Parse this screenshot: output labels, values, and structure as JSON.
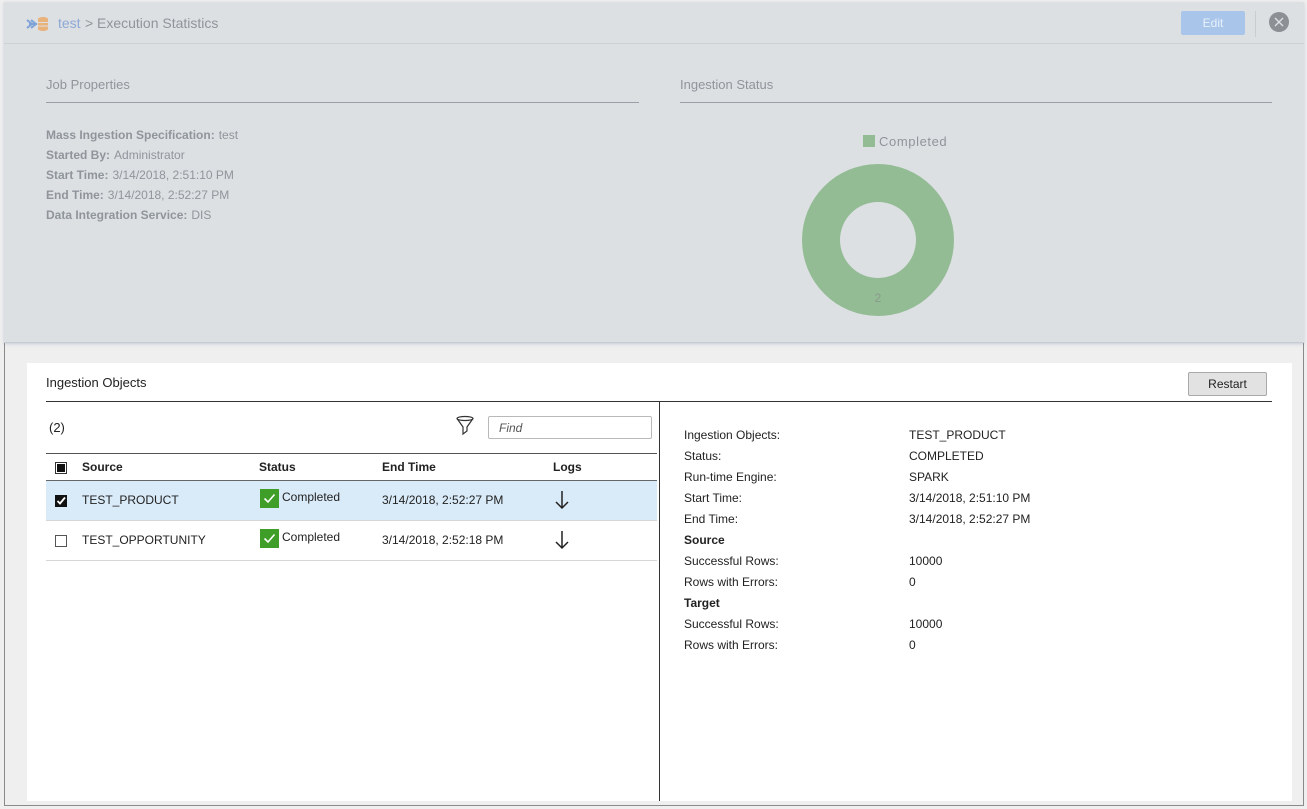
{
  "header": {
    "breadcrumb_link": "test",
    "breadcrumb_separator": ">",
    "page_title": "Execution Statistics",
    "edit_label": "Edit",
    "close_icon": "close-icon",
    "app_icon": "mass-ingestion-icon"
  },
  "job_properties": {
    "title": "Job Properties",
    "items": [
      {
        "label": "Mass Ingestion Specification:",
        "value": "test"
      },
      {
        "label": "Started By:",
        "value": "Administrator"
      },
      {
        "label": "Start Time:",
        "value": "3/14/2018, 2:51:10 PM"
      },
      {
        "label": "End Time:",
        "value": "3/14/2018, 2:52:27 PM"
      },
      {
        "label": "Data Integration Service:",
        "value": "DIS"
      }
    ]
  },
  "ingestion_status": {
    "title": "Ingestion Status"
  },
  "chart_data": {
    "type": "pie",
    "variant": "donut",
    "title": "Ingestion Status",
    "categories": [
      "Completed"
    ],
    "values": [
      2
    ],
    "colors": [
      "#93bc95"
    ],
    "data_labels": [
      "2"
    ],
    "legend": {
      "entries": [
        "Completed"
      ],
      "placement": "top"
    }
  },
  "ingestion_objects": {
    "title": "Ingestion Objects",
    "restart_label": "Restart",
    "count_label": "(2)",
    "find_placeholder": "Find",
    "filter_icon": "filter-icon",
    "columns": [
      "Source",
      "Status",
      "End Time",
      "Logs"
    ],
    "rows": [
      {
        "source": "TEST_PRODUCT",
        "status": "Completed",
        "end_time": "3/14/2018, 2:52:27 PM",
        "checked": true,
        "selected": true
      },
      {
        "source": "TEST_OPPORTUNITY",
        "status": "Completed",
        "end_time": "3/14/2018, 2:52:18 PM",
        "checked": false,
        "selected": false
      }
    ],
    "status_color": "#3e9e27",
    "selected_row_color": "#d9eaf8"
  },
  "details": {
    "rows": [
      {
        "label": "Ingestion Objects:",
        "value": "TEST_PRODUCT"
      },
      {
        "label": "Status:",
        "value": "COMPLETED"
      },
      {
        "label": "Run-time Engine:",
        "value": "SPARK"
      },
      {
        "label": "Start Time:",
        "value": "3/14/2018, 2:51:10 PM"
      },
      {
        "label": "End Time:",
        "value": "3/14/2018, 2:52:27 PM"
      }
    ],
    "source_heading": "Source",
    "source_rows": [
      {
        "label": "Successful Rows:",
        "value": "10000"
      },
      {
        "label": "Rows with Errors:",
        "value": "0"
      }
    ],
    "target_heading": "Target",
    "target_rows": [
      {
        "label": "Successful Rows:",
        "value": "10000"
      },
      {
        "label": "Rows with Errors:",
        "value": "0"
      }
    ]
  },
  "colors": {
    "accent_link": "#8da8d6",
    "edit_button": "#a9c6ea",
    "overlay_bg": "#dde0e3"
  }
}
